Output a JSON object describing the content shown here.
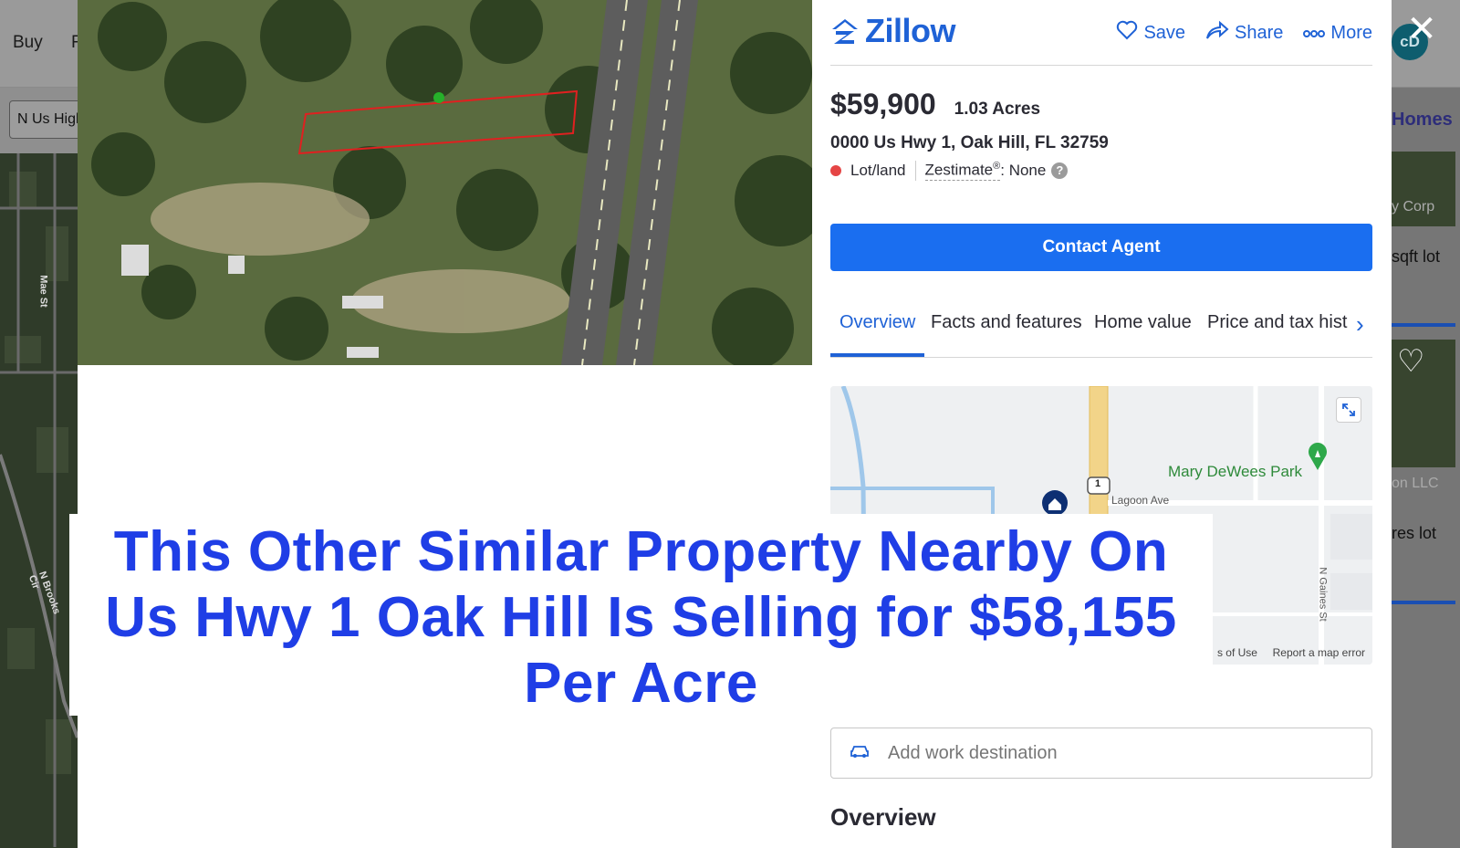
{
  "background": {
    "nav": {
      "buy": "Buy",
      "partial": "R"
    },
    "search_value": "N Us High",
    "right_panel": {
      "homes_link": "Homes",
      "card1_faint": "y Corp",
      "card1_text": "sqft lot",
      "card2_faint": "on LLC",
      "card2_text": "res lot"
    },
    "map_labels": {
      "mae": "Mae St",
      "brooks": "N Brooks Cir"
    },
    "avatar": "cD"
  },
  "header": {
    "brand": "Zillow",
    "save": "Save",
    "share": "Share",
    "more": "More"
  },
  "listing": {
    "price": "$59,900",
    "acres": "1.03 Acres",
    "address": "0000 Us Hwy 1, Oak Hill, FL 32759",
    "type": "Lot/land",
    "zestimate_label": "Zestimate",
    "zestimate_sup": "®",
    "zestimate_value": ": None",
    "help": "?"
  },
  "contact_label": "Contact Agent",
  "tabs": [
    "Overview",
    "Facts and features",
    "Home value",
    "Price and tax hist"
  ],
  "map": {
    "park": "Mary DeWees Park",
    "road": "Lagoon Ave",
    "highway_shield": "1",
    "street": "N Gaines St",
    "terms": "s of Use",
    "report": "Report a map error"
  },
  "work_destination_placeholder": "Add work destination",
  "overview_heading": "Overview",
  "caption": {
    "line1": "This Other Similar Property Nearby On",
    "line2": "Us Hwy 1 Oak Hill Is Selling for $58,155",
    "line3": "Per Acre"
  },
  "colors": {
    "zillow_blue": "#1f62d6",
    "button_blue": "#1a6ef0",
    "caption_blue": "#1f3ee6",
    "status_red": "#e54545"
  }
}
